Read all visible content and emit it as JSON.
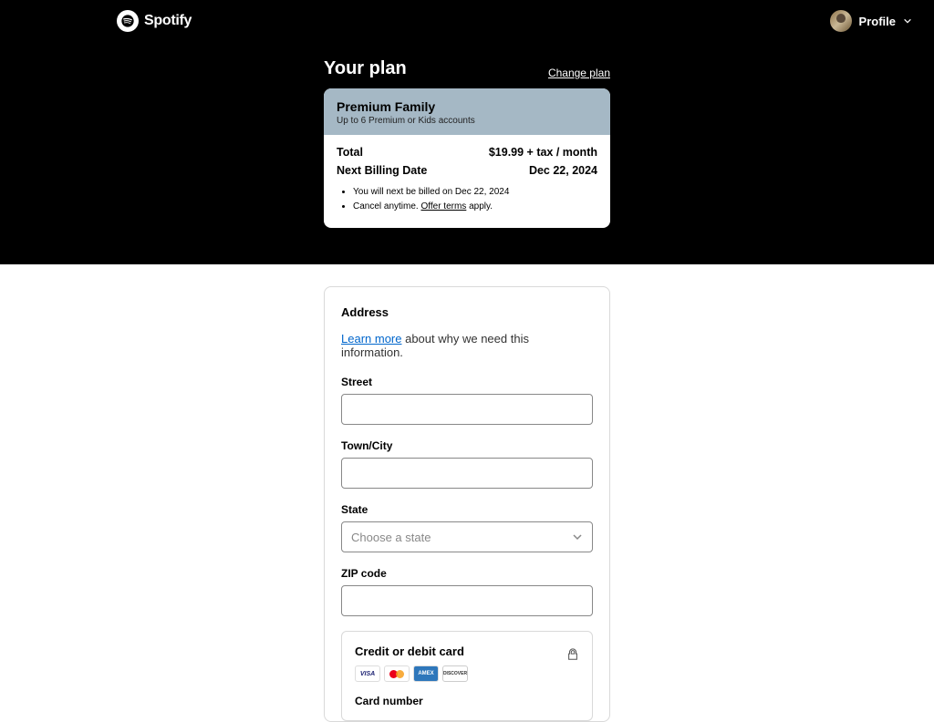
{
  "header": {
    "brand": "Spotify",
    "profile_label": "Profile"
  },
  "plan_section": {
    "title": "Your plan",
    "change_label": "Change plan",
    "plan_name": "Premium Family",
    "plan_sub": "Up to 6 Premium or Kids accounts",
    "rows": {
      "total_label": "Total",
      "total_value": "$19.99 + tax / month",
      "next_label": "Next Billing Date",
      "next_value": "Dec 22, 2024"
    },
    "bullets": {
      "b1": "You will next be billed on Dec 22, 2024",
      "b2_before": "Cancel anytime. ",
      "b2_link": "Offer terms",
      "b2_after": " apply."
    }
  },
  "address": {
    "section_title": "Address",
    "learn_more": "Learn more",
    "info_after": " about why we need this information.",
    "street_label": "Street",
    "city_label": "Town/City",
    "state_label": "State",
    "state_placeholder": "Choose a state",
    "zip_label": "ZIP code"
  },
  "payment": {
    "title": "Credit or debit card",
    "card_number_label": "Card number",
    "cards": {
      "visa": "VISA",
      "amex": "AMEX",
      "discover": "DISCOVER"
    }
  }
}
